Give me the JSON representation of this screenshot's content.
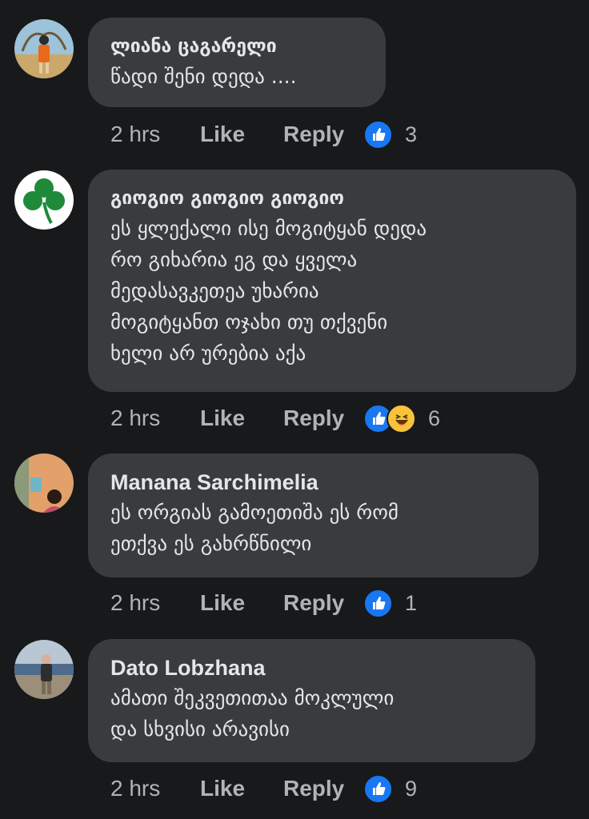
{
  "colors": {
    "background": "#18191a",
    "bubble": "#3a3b3c",
    "text_primary": "#e4e6eb",
    "text_secondary": "#b0b3b8",
    "like_blue": "#1877f2"
  },
  "action_labels": {
    "like": "Like",
    "reply": "Reply"
  },
  "comments": [
    {
      "author": "ლიანა ცაგარელი",
      "text": "წადი შენი დედა ....",
      "time": "2 hrs",
      "reactions": [
        "like-icon"
      ],
      "reaction_count": "3"
    },
    {
      "author": "გიოგიო გიოგიო გიოგიო",
      "text": "ეს ყლექალი ისე მოგიტყან დედა\nრო გიხარია ეგ და ყველა\nმედასავკეთეა უხარია\nმოგიტყანთ ოჯახი თუ თქვენი\nხელი არ ურებია აქა",
      "time": "2 hrs",
      "reactions": [
        "like-icon",
        "haha-icon"
      ],
      "reaction_count": "6"
    },
    {
      "author": "Manana Sarchimelia",
      "text": "ეს ორგიას გამოეთიშა ეს რომ\nეთქვა ეს გახრწნილი",
      "time": "2 hrs",
      "reactions": [
        "like-icon"
      ],
      "reaction_count": "1"
    },
    {
      "author": "Dato Lobzhana",
      "text": "ამათი შეკვეთითაა  მოკლული\nდა სხვისი არავისი",
      "time": "2 hrs",
      "reactions": [
        "like-icon"
      ],
      "reaction_count": "9"
    }
  ]
}
